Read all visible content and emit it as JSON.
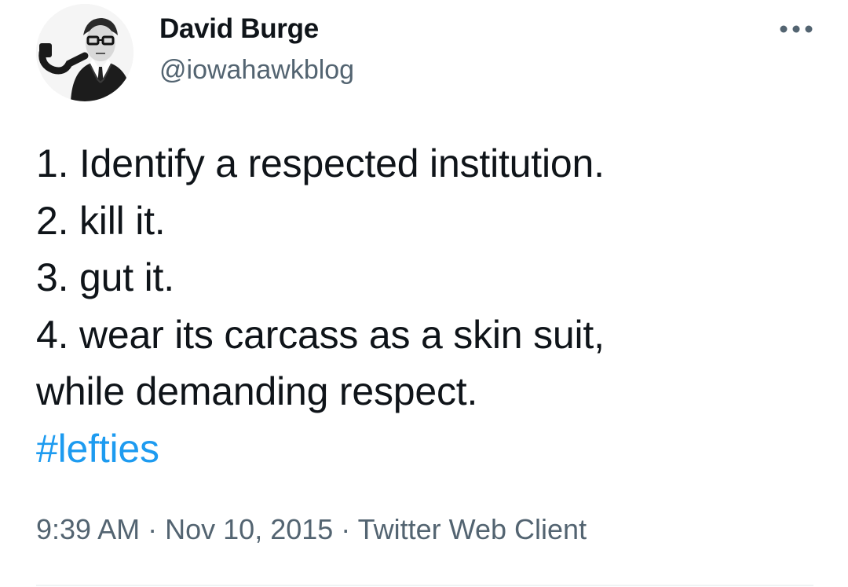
{
  "author": {
    "display_name": "David Burge",
    "handle": "@iowahawkblog"
  },
  "tweet": {
    "lines": [
      "1. Identify a respected institution.",
      "2. kill it.",
      "3. gut it.",
      "4. wear its carcass as a skin suit,",
      "while demanding respect."
    ],
    "hashtag": "#lefties"
  },
  "meta": {
    "time": "9:39 AM",
    "separator": "·",
    "date": "Nov 10, 2015",
    "client": "Twitter Web Client"
  },
  "icons": {
    "more": "more-horizontal-icon",
    "avatar": "profile-photo"
  },
  "colors": {
    "text": "#0f1419",
    "secondary": "#536471",
    "link": "#1d9bf0",
    "divider": "#eff3f4"
  }
}
